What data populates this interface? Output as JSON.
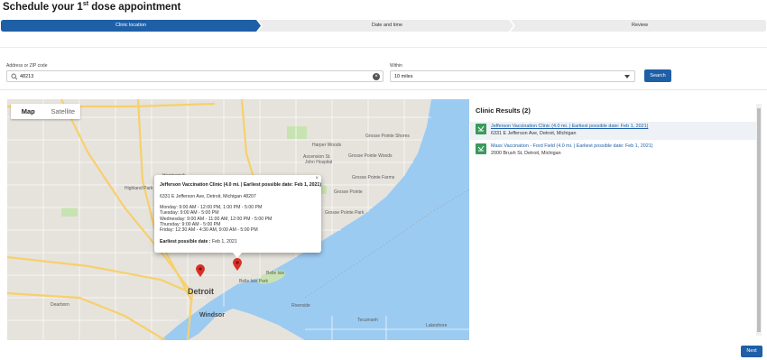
{
  "page": {
    "title_prefix": "Schedule your 1",
    "title_sup": "st",
    "title_suffix": " dose appointment"
  },
  "stepper": {
    "steps": [
      {
        "label": "Clinic location",
        "active": true
      },
      {
        "label": "Date and time",
        "active": false
      },
      {
        "label": "Review",
        "active": false
      }
    ]
  },
  "form": {
    "address_label": "Address or ZIP code",
    "address_value": "48213",
    "within_label": "Within",
    "within_value": "10 miles",
    "search_label": "Search"
  },
  "map": {
    "toggle_map": "Map",
    "toggle_satellite": "Satellite",
    "labels": {
      "harper_woods": "Harper Woods",
      "ascension": "Ascension St.",
      "john_hospital": "John Hospital",
      "grosse_pointe_shores": "Grosse Pointe\nShores",
      "grosse_pointe_woods": "Grosse Pointe\nWoods",
      "grosse_pointe_farms": "Grosse Pointe\nFarms",
      "grosse_pointe_park": "Grosse Pointe Park",
      "grosse_pointe": "Grosse Pointe",
      "belle_isle": "Belle Isle",
      "belle_isle_park": "Belle Isle Park",
      "detroit": "Detroit",
      "windsor": "Windsor",
      "dearborn": "Dearborn",
      "tecumseh": "Tecumseh",
      "lakeshore": "Lakeshore",
      "riverside": "Riverside",
      "highland_park": "Highland Park",
      "hamtramck": "Hamtramck"
    },
    "colors": {
      "land": "#e6e3dd",
      "water": "#9ccbf2",
      "highway": "#f7d06b",
      "road": "#ffffff",
      "park": "#c8e3b2",
      "pin": "#d93025"
    }
  },
  "popup": {
    "title": "Jefferson Vaccination Clinic (4.0 mi. | Earliest possible date: Feb 1, 2021)",
    "address": "6331 E Jefferson Ave, Detroit, Michigan 48207",
    "hours": [
      "Monday: 9:00 AM - 12:00 PM, 1:00 PM - 5:00 PM",
      "Tuesday: 9:00 AM - 5:00 PM",
      "Wednesday: 9:00 AM - 11:00 AM, 12:00 PM - 5:00 PM",
      "Thursday: 9:00 AM - 5:00 PM",
      "Friday: 12:30 AM - 4:30 AM, 9:00 AM - 5:00 PM"
    ],
    "earliest_label": "Earliest possible date :",
    "earliest_value": " Feb 1, 2021",
    "close_glyph": "×"
  },
  "results": {
    "title": "Clinic Results (2)",
    "items": [
      {
        "link": "Jefferson Vaccination Clinic (4.0 mi. | Earliest possible date: Feb 1, 2021)",
        "address": "6331 E Jefferson Ave, Detroit, Michigan"
      },
      {
        "link": "Mass Vaccination - Ford Field (4.0 mi. | Earliest possible date: Feb 1, 2021)",
        "address": "2000 Brush St, Detroit, Michigan"
      }
    ]
  },
  "footer": {
    "next_label": "Next"
  }
}
